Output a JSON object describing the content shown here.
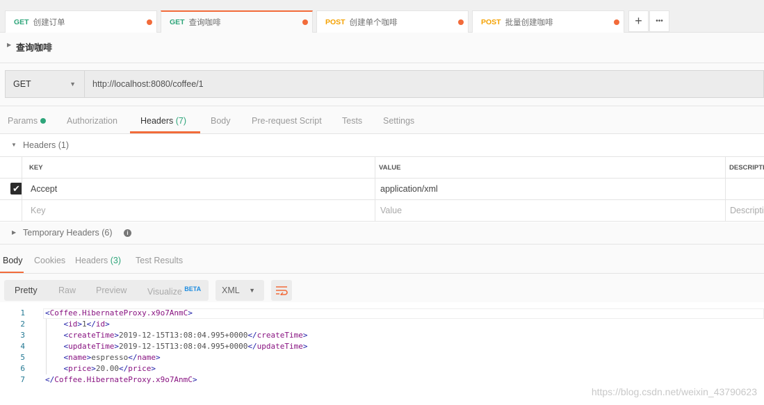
{
  "tabs": [
    {
      "method": "GET",
      "name": "创建订单",
      "active": false
    },
    {
      "method": "GET",
      "name": "查询咖啡",
      "active": true
    },
    {
      "method": "POST",
      "name": "创建单个咖啡",
      "active": false
    },
    {
      "method": "POST",
      "name": "批量创建咖啡",
      "active": false
    }
  ],
  "tab_actions": {
    "add": "+",
    "more": "•••"
  },
  "request": {
    "name": "查询咖啡",
    "method": "GET",
    "url": "http://localhost:8080/coffee/1"
  },
  "request_tabs": {
    "params": "Params",
    "authorization": "Authorization",
    "headers": "Headers",
    "headers_count": "(7)",
    "body": "Body",
    "prerequest": "Pre-request Script",
    "tests": "Tests",
    "settings": "Settings"
  },
  "headers_section": {
    "title": "Headers (1)",
    "columns": {
      "key": "KEY",
      "value": "VALUE",
      "description": "DESCRIPTI"
    },
    "rows": [
      {
        "checked": true,
        "key": "Accept",
        "value": "application/xml",
        "description": ""
      }
    ],
    "placeholders": {
      "key": "Key",
      "value": "Value",
      "description": "Descripti"
    }
  },
  "temporary_headers": "Temporary Headers (6)",
  "response_tabs": {
    "body": "Body",
    "cookies": "Cookies",
    "headers": "Headers",
    "headers_count": "(3)",
    "test_results": "Test Results"
  },
  "response_toolbar": {
    "pretty": "Pretty",
    "raw": "Raw",
    "preview": "Preview",
    "visualize": "Visualize",
    "beta": "BETA",
    "format": "XML"
  },
  "response_lines": [
    {
      "n": "1",
      "indent": 0,
      "tag": "Coffee.HibernateProxy.x9o7AnmC",
      "text": "",
      "close": false,
      "open": true
    },
    {
      "n": "2",
      "indent": 1,
      "tag": "id",
      "text": "1"
    },
    {
      "n": "3",
      "indent": 1,
      "tag": "createTime",
      "text": "2019-12-15T13:08:04.995+0000"
    },
    {
      "n": "4",
      "indent": 1,
      "tag": "updateTime",
      "text": "2019-12-15T13:08:04.995+0000"
    },
    {
      "n": "5",
      "indent": 1,
      "tag": "name",
      "text": "espresso"
    },
    {
      "n": "6",
      "indent": 1,
      "tag": "price",
      "text": "20.00"
    },
    {
      "n": "7",
      "indent": 0,
      "tag": "Coffee.HibernateProxy.x9o7AnmC",
      "text": "",
      "closeOnly": true
    }
  ],
  "watermark": "https://blog.csdn.net/weixin_43790623",
  "colors": {
    "accent": "#f26b3a",
    "get": "#2ea57a",
    "post": "#f4a100"
  }
}
